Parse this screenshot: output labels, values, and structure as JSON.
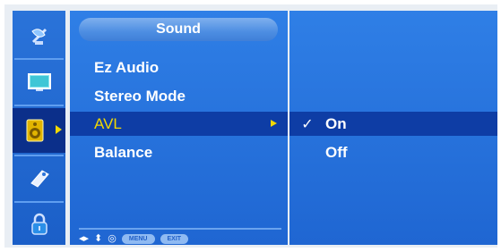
{
  "menu": {
    "title": "Sound",
    "items": [
      {
        "label": "Ez Audio"
      },
      {
        "label": "Stereo Mode"
      },
      {
        "label": "AVL"
      },
      {
        "label": "Balance"
      }
    ]
  },
  "submenu": {
    "options": [
      {
        "label": "On",
        "checked": "✓"
      },
      {
        "label": "Off",
        "checked": ""
      }
    ]
  },
  "sidebar": {
    "icons": [
      "satellite-dish-icon",
      "screen-icon",
      "speaker-icon",
      "tag-icon",
      "lock-icon"
    ],
    "selected_index": 2
  },
  "hints": {
    "nav": "◂▸",
    "updown": "⬍",
    "ok": "◎",
    "menu": "MENU",
    "exit": "EXIT"
  },
  "colors": {
    "panel": "#1f66d2",
    "selected": "#0e3da5",
    "highlight_text": "#f2d800"
  }
}
